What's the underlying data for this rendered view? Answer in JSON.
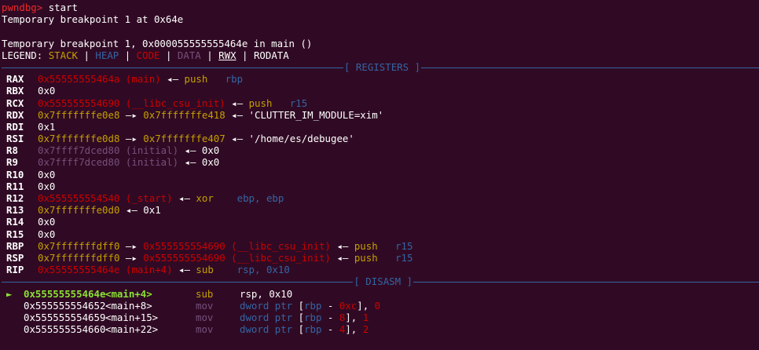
{
  "prompt": "pwndbg>",
  "command": "start",
  "messages": [
    "Temporary breakpoint 1 at 0x64e",
    "",
    "Temporary breakpoint 1, 0x000055555555464e in main ()"
  ],
  "legend": {
    "label": "LEGEND:",
    "stack": "STACK",
    "heap": "HEAP",
    "code": "CODE",
    "data": "DATA",
    "rwx": "RWX",
    "rodata": "RODATA",
    "sep": "|"
  },
  "registers_title": "[ REGISTERS ]",
  "registers": [
    {
      "name": "RAX",
      "parts": [
        [
          "red",
          "0x55555555464a (main)"
        ],
        [
          "white",
          " ◂— "
        ],
        [
          "yellow",
          "push   "
        ],
        [
          "blue",
          "rbp"
        ]
      ]
    },
    {
      "name": "RBX",
      "parts": [
        [
          "white",
          "0x0"
        ]
      ]
    },
    {
      "name": "RCX",
      "parts": [
        [
          "red",
          "0x555555554690 (__libc_csu_init)"
        ],
        [
          "white",
          " ◂— "
        ],
        [
          "yellow",
          "push   "
        ],
        [
          "blue",
          "r15"
        ]
      ]
    },
    {
      "name": "RDX",
      "parts": [
        [
          "yellow",
          "0x7fffffffe0e8"
        ],
        [
          "white",
          " —▸ "
        ],
        [
          "yellow",
          "0x7fffffffe418"
        ],
        [
          "white",
          " ◂— 'CLUTTER_IM_MODULE=xim'"
        ]
      ]
    },
    {
      "name": "RDI",
      "parts": [
        [
          "white",
          "0x1"
        ]
      ]
    },
    {
      "name": "RSI",
      "parts": [
        [
          "yellow",
          "0x7fffffffe0d8"
        ],
        [
          "white",
          " —▸ "
        ],
        [
          "yellow",
          "0x7fffffffe407"
        ],
        [
          "white",
          " ◂— '/home/es/debugee'"
        ]
      ]
    },
    {
      "name": "R8",
      "parts": [
        [
          "purple",
          "0x7ffff7dced80 (initial)"
        ],
        [
          "white",
          " ◂— 0x0"
        ]
      ]
    },
    {
      "name": "R9",
      "parts": [
        [
          "purple",
          "0x7ffff7dced80 (initial)"
        ],
        [
          "white",
          " ◂— 0x0"
        ]
      ]
    },
    {
      "name": "R10",
      "parts": [
        [
          "white",
          "0x0"
        ]
      ]
    },
    {
      "name": "R11",
      "parts": [
        [
          "white",
          "0x0"
        ]
      ]
    },
    {
      "name": "R12",
      "parts": [
        [
          "red",
          "0x555555554540 (_start)"
        ],
        [
          "white",
          " ◂— "
        ],
        [
          "yellow",
          "xor    "
        ],
        [
          "blue",
          "ebp, ebp"
        ]
      ]
    },
    {
      "name": "R13",
      "parts": [
        [
          "yellow",
          "0x7fffffffe0d0"
        ],
        [
          "white",
          " ◂— 0x1"
        ]
      ]
    },
    {
      "name": "R14",
      "parts": [
        [
          "white",
          "0x0"
        ]
      ]
    },
    {
      "name": "R15",
      "parts": [
        [
          "white",
          "0x0"
        ]
      ]
    },
    {
      "name": "RBP",
      "parts": [
        [
          "yellow",
          "0x7fffffffdff0"
        ],
        [
          "white",
          " —▸ "
        ],
        [
          "red",
          "0x555555554690 (__libc_csu_init)"
        ],
        [
          "white",
          " ◂— "
        ],
        [
          "yellow",
          "push   "
        ],
        [
          "blue",
          "r15"
        ]
      ]
    },
    {
      "name": "RSP",
      "parts": [
        [
          "yellow",
          "0x7fffffffdff0"
        ],
        [
          "white",
          " —▸ "
        ],
        [
          "red",
          "0x555555554690 (__libc_csu_init)"
        ],
        [
          "white",
          " ◂— "
        ],
        [
          "yellow",
          "push   "
        ],
        [
          "blue",
          "r15"
        ]
      ]
    },
    {
      "name": "RIP",
      "parts": [
        [
          "red",
          "0x55555555464e (main+4)"
        ],
        [
          "white",
          " ◂— "
        ],
        [
          "yellow",
          "sub    "
        ],
        [
          "blue",
          "rsp, 0x10"
        ]
      ]
    }
  ],
  "disasm_title": "[ DISASM ]",
  "disasm": [
    {
      "current": true,
      "arrow": "►",
      "addr": "0x55555555464e",
      "sym": "<main+4>",
      "mnemonic": "sub",
      "operands": [
        [
          "reg",
          "rsp"
        ],
        [
          "txt",
          ", "
        ],
        [
          "num",
          "0x10"
        ]
      ]
    },
    {
      "current": false,
      "arrow": "",
      "addr": "0x555555554652",
      "sym": "<main+8>",
      "mnemonic": "mov",
      "operands": [
        [
          "blue",
          "dword ptr "
        ],
        [
          "txt",
          "["
        ],
        [
          "reg",
          "rbp"
        ],
        [
          "txt",
          " - "
        ],
        [
          "num",
          "0xc"
        ],
        [
          "txt",
          "], "
        ],
        [
          "num",
          "0"
        ]
      ]
    },
    {
      "current": false,
      "arrow": "",
      "addr": "0x555555554659",
      "sym": "<main+15>",
      "mnemonic": "mov",
      "operands": [
        [
          "blue",
          "dword ptr "
        ],
        [
          "txt",
          "["
        ],
        [
          "reg",
          "rbp"
        ],
        [
          "txt",
          " - "
        ],
        [
          "num",
          "8"
        ],
        [
          "txt",
          "], "
        ],
        [
          "num",
          "1"
        ]
      ]
    },
    {
      "current": false,
      "arrow": "",
      "addr": "0x555555554660",
      "sym": "<main+22>",
      "mnemonic": "mov",
      "operands": [
        [
          "blue",
          "dword ptr "
        ],
        [
          "txt",
          "["
        ],
        [
          "reg",
          "rbp"
        ],
        [
          "txt",
          " - "
        ],
        [
          "num",
          "4"
        ],
        [
          "txt",
          "], "
        ],
        [
          "num",
          "2"
        ]
      ]
    }
  ]
}
